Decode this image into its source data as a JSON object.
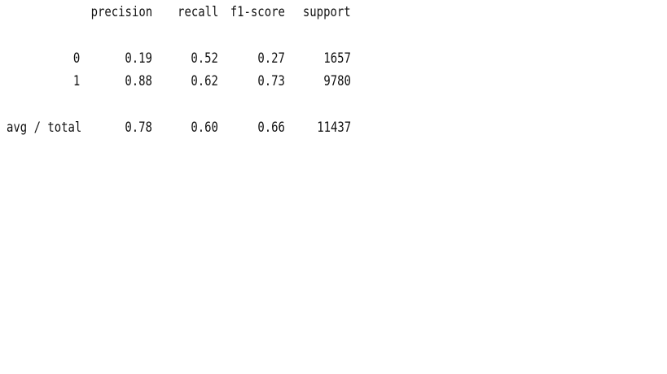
{
  "report": {
    "headers": [
      "precision",
      "recall",
      "f1-score",
      "support"
    ],
    "rows": [
      {
        "label": "0",
        "precision": "0.19",
        "recall": "0.52",
        "f1": "0.27",
        "support": "1657"
      },
      {
        "label": "1",
        "precision": "0.88",
        "recall": "0.62",
        "f1": "0.73",
        "support": "9780"
      }
    ],
    "summary": {
      "label": "avg / total",
      "precision": "0.78",
      "recall": "0.60",
      "f1": "0.66",
      "support": "11437"
    }
  }
}
